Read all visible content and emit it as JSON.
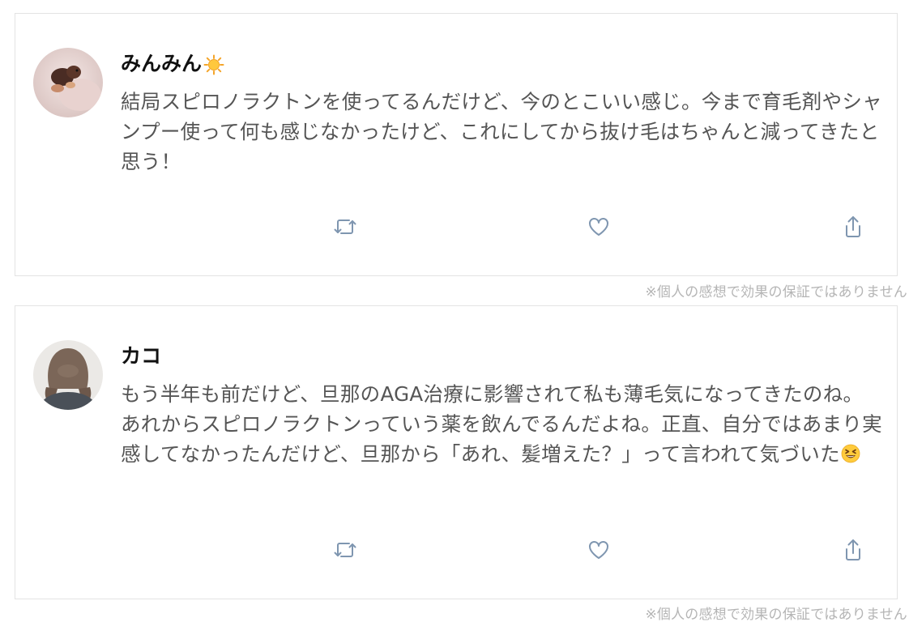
{
  "posts": [
    {
      "author": "みんみん",
      "author_emoji": "sun-emoji",
      "text": "結局スピロノラクトンを使ってるんだけど、今のとこいい感じ。今まで育毛剤やシャンプー使って何も感じなかったけど、これにしてから抜け毛はちゃんと減ってきたと思う！",
      "text_emoji": null,
      "actions": [
        "retweet-icon",
        "heart-icon",
        "share-icon"
      ],
      "disclaimer": "※個人の感想で効果の保証ではありません"
    },
    {
      "author": "カコ",
      "author_emoji": null,
      "text": "もう半年も前だけど、旦那のAGA治療に影響されて私も薄毛気になってきたのね。あれからスピロノラクトンっていう薬を飲んでるんだよね。正直、自分ではあまり実感してなかったんだけど、旦那から「あれ、髪増えた？」って言われて気づいた",
      "text_emoji": "grinning-squinting-face-emoji",
      "actions": [
        "retweet-icon",
        "heart-icon",
        "share-icon"
      ],
      "disclaimer": "※個人の感想で効果の保証ではありません"
    }
  ],
  "colors": {
    "card_border": "#e3e3e3",
    "body_text": "#555555",
    "name_text": "#111111",
    "icon": "#7f96b0",
    "disclaimer": "#b5b5b5"
  }
}
